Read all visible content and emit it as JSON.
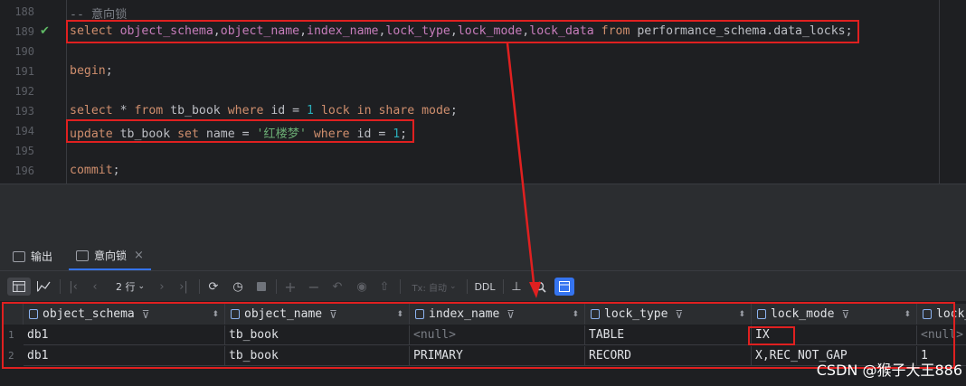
{
  "editor": {
    "lines": [
      {
        "no": "188",
        "parts": [
          {
            "t": "-- 意向锁",
            "c": "cmt"
          }
        ]
      },
      {
        "no": "189",
        "check": true,
        "parts": [
          {
            "t": "select ",
            "c": "kw"
          },
          {
            "t": "object_schema",
            "c": "fn"
          },
          {
            "t": ",",
            "c": ""
          },
          {
            "t": "object_name",
            "c": "fn"
          },
          {
            "t": ",",
            "c": ""
          },
          {
            "t": "index_name",
            "c": "fn"
          },
          {
            "t": ",",
            "c": ""
          },
          {
            "t": "lock_type",
            "c": "fn"
          },
          {
            "t": ",",
            "c": ""
          },
          {
            "t": "lock_mode",
            "c": "fn"
          },
          {
            "t": ",",
            "c": ""
          },
          {
            "t": "lock_data",
            "c": "fn"
          },
          {
            "t": " from ",
            "c": "kw"
          },
          {
            "t": "performance_schema.data_locks;",
            "c": ""
          }
        ]
      },
      {
        "no": "190",
        "parts": []
      },
      {
        "no": "191",
        "parts": [
          {
            "t": "begin",
            "c": "kw"
          },
          {
            "t": ";",
            "c": ""
          }
        ]
      },
      {
        "no": "192",
        "parts": []
      },
      {
        "no": "193",
        "parts": [
          {
            "t": "select",
            "c": "kw"
          },
          {
            "t": " * ",
            "c": ""
          },
          {
            "t": "from",
            "c": "kw"
          },
          {
            "t": " tb_book ",
            "c": ""
          },
          {
            "t": "where",
            "c": "kw"
          },
          {
            "t": " id = ",
            "c": ""
          },
          {
            "t": "1",
            "c": "num"
          },
          {
            "t": " lock in share mode",
            "c": "kw"
          },
          {
            "t": ";",
            "c": ""
          }
        ]
      },
      {
        "no": "194",
        "parts": [
          {
            "t": "update",
            "c": "kw"
          },
          {
            "t": " tb_book ",
            "c": ""
          },
          {
            "t": "set",
            "c": "kw"
          },
          {
            "t": " name = ",
            "c": ""
          },
          {
            "t": "'红楼梦'",
            "c": "str"
          },
          {
            "t": " where",
            "c": "kw"
          },
          {
            "t": " id = ",
            "c": ""
          },
          {
            "t": "1",
            "c": "num"
          },
          {
            "t": ";",
            "c": ""
          }
        ]
      },
      {
        "no": "195",
        "parts": []
      },
      {
        "no": "196",
        "parts": [
          {
            "t": "commit",
            "c": "kw"
          },
          {
            "t": ";",
            "c": ""
          }
        ]
      }
    ]
  },
  "tabs": {
    "output_label": "输出",
    "result_label": "意向锁",
    "close_glyph": "×"
  },
  "toolbar": {
    "rows_label": "2 行",
    "tx_label": "Tx: 自动",
    "ddl_label": "DDL"
  },
  "grid": {
    "columns": [
      "object_schema",
      "object_name",
      "index_name",
      "lock_type",
      "lock_mode",
      "lock_data"
    ],
    "rows": [
      {
        "num": "1",
        "cells": [
          "db1",
          "tb_book",
          "<null>",
          "TABLE",
          "IX",
          "<null>"
        ]
      },
      {
        "num": "2",
        "cells": [
          "db1",
          "tb_book",
          "PRIMARY",
          "RECORD",
          "X,REC_NOT_GAP",
          "1"
        ]
      }
    ],
    "null_text": "<null>"
  },
  "watermark": "CSDN @猴子大王886",
  "colors": {
    "annotation_red": "#e02020",
    "keyword": "#cf8e6d",
    "identifier": "#c77dbb",
    "string": "#6aab73",
    "number": "#2aacb8",
    "accent_blue": "#3574f0"
  }
}
